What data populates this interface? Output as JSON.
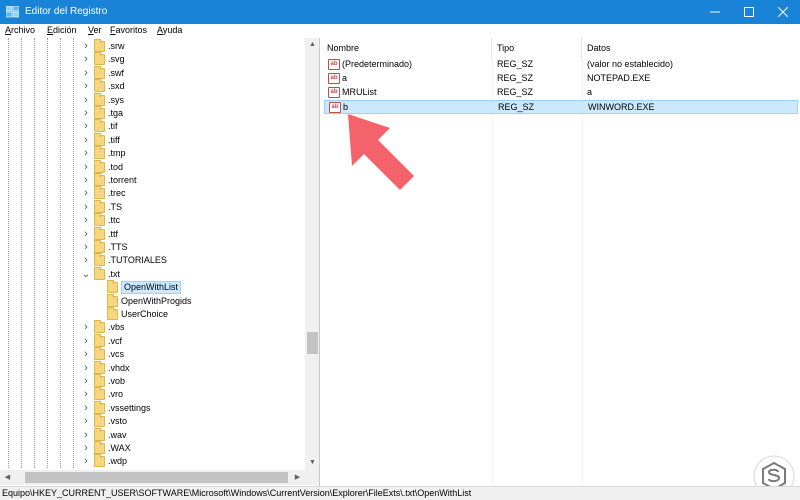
{
  "window": {
    "title": "Editor del Registro",
    "title_color": "#1883d7",
    "controls": {
      "minimize": "minimize-icon",
      "maximize": "maximize-icon",
      "close": "close-icon"
    }
  },
  "menu": {
    "items": [
      {
        "accel": "A",
        "rest": "rchivo"
      },
      {
        "accel": "E",
        "rest": "dición"
      },
      {
        "accel": "V",
        "rest": "er"
      },
      {
        "accel": "F",
        "rest": "avoritos"
      },
      {
        "accel": "A",
        "rest": "yuda"
      }
    ]
  },
  "tree": {
    "items": [
      {
        "label": ".srw",
        "expanded": false
      },
      {
        "label": ".svg",
        "expanded": false
      },
      {
        "label": ".swf",
        "expanded": false
      },
      {
        "label": ".sxd",
        "expanded": false
      },
      {
        "label": ".sys",
        "expanded": false
      },
      {
        "label": ".tga",
        "expanded": false
      },
      {
        "label": ".tif",
        "expanded": false
      },
      {
        "label": ".tiff",
        "expanded": false
      },
      {
        "label": ".tmp",
        "expanded": false
      },
      {
        "label": ".tod",
        "expanded": false
      },
      {
        "label": ".torrent",
        "expanded": false
      },
      {
        "label": ".trec",
        "expanded": false
      },
      {
        "label": ".TS",
        "expanded": false
      },
      {
        "label": ".ttc",
        "expanded": false
      },
      {
        "label": ".ttf",
        "expanded": false
      },
      {
        "label": ".TTS",
        "expanded": false
      },
      {
        "label": ".TUTORIALES",
        "expanded": false
      },
      {
        "label": ".txt",
        "expanded": true
      },
      {
        "label": "OpenWithList",
        "child": true,
        "selected": true
      },
      {
        "label": "OpenWithProgids",
        "child": true
      },
      {
        "label": "UserChoice",
        "child": true
      },
      {
        "label": ".vbs",
        "expanded": false
      },
      {
        "label": ".vcf",
        "expanded": false
      },
      {
        "label": ".vcs",
        "expanded": false
      },
      {
        "label": ".vhdx",
        "expanded": false
      },
      {
        "label": ".vob",
        "expanded": false
      },
      {
        "label": ".vro",
        "expanded": false
      },
      {
        "label": ".vssettings",
        "expanded": false
      },
      {
        "label": ".vsto",
        "expanded": false
      },
      {
        "label": ".wav",
        "expanded": false
      },
      {
        "label": ".WAX",
        "expanded": false
      },
      {
        "label": ".wdp",
        "expanded": false
      }
    ]
  },
  "values": {
    "columns": [
      "Nombre",
      "Tipo",
      "Datos"
    ],
    "rows": [
      {
        "name": "(Predeterminado)",
        "type": "REG_SZ",
        "data": "(valor no establecido)",
        "selected": false
      },
      {
        "name": "a",
        "type": "REG_SZ",
        "data": "NOTEPAD.EXE",
        "selected": false
      },
      {
        "name": "MRUList",
        "type": "REG_SZ",
        "data": "a",
        "selected": false
      },
      {
        "name": "b",
        "type": "REG_SZ",
        "data": "WINWORD.EXE",
        "selected": true
      }
    ],
    "value_icon": "ab",
    "selection_color": "#cce8ff"
  },
  "status": {
    "path": "Equipo\\HKEY_CURRENT_USER\\SOFTWARE\\Microsoft\\Windows\\CurrentVersion\\Explorer\\FileExts\\.txt\\OpenWithList"
  },
  "annotation": {
    "arrow_color": "#f4636b"
  }
}
